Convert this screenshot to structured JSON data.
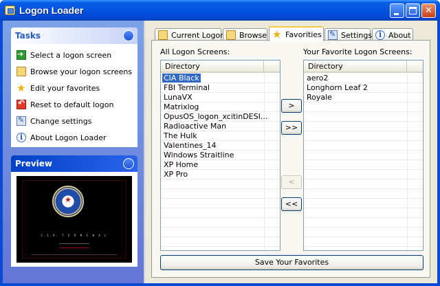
{
  "window": {
    "title": "Logon Loader"
  },
  "tasks": {
    "header": "Tasks",
    "items": [
      {
        "label": "Select a logon screen",
        "icon": "green-arrow-icon"
      },
      {
        "label": "Browse your logon screens",
        "icon": "folder-icon"
      },
      {
        "label": "Edit your favorites",
        "icon": "star-icon"
      },
      {
        "label": "Reset to default logon",
        "icon": "reset-icon"
      },
      {
        "label": "Change settings",
        "icon": "settings-icon"
      },
      {
        "label": "About Logon Loader",
        "icon": "info-icon"
      }
    ]
  },
  "preview": {
    "header": "Preview",
    "screen_text": "C.I.A.  T E R M I N A L"
  },
  "tabs": [
    {
      "label": "Current Logon",
      "icon": "folder-key-icon",
      "active": false
    },
    {
      "label": "Browse",
      "icon": "folder-icon",
      "active": false
    },
    {
      "label": "Favorities",
      "icon": "star-icon",
      "active": true
    },
    {
      "label": "Settings",
      "icon": "settings-icon",
      "active": false
    },
    {
      "label": "About",
      "icon": "info-icon",
      "active": false
    }
  ],
  "favorites_tab": {
    "all_label": "All Logon Screens:",
    "fav_label": "Your Favorite Logon Screens:",
    "column_header": "Directory",
    "all_screens": [
      "CIA Black",
      "FBI Terminal",
      "LunaVX",
      "Matrixlog",
      "OpusOS_logon_xcitinDESI...",
      "Radioactive Man",
      "The Hulk",
      "Valentines_14",
      "Windows Straitline",
      "XP Home",
      "XP Pro"
    ],
    "selected_index": 0,
    "favorites": [
      "aero2",
      "Longhorn Leaf 2",
      "Royale"
    ],
    "buttons": {
      "add": ">",
      "add_all": ">>",
      "remove": "<",
      "remove_all": "<<"
    },
    "save_label": "Save Your Favorites"
  },
  "colors": {
    "titlebar": "#0052e0",
    "selection": "#316ac5",
    "active_tab_accent": "#ffc83c"
  }
}
